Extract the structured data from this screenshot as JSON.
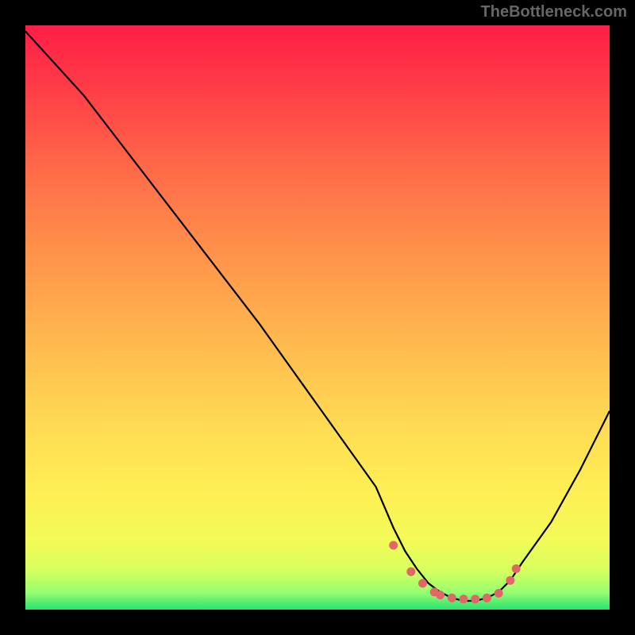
{
  "watermark": "TheBottleneck.com",
  "chart_data": {
    "type": "line",
    "title": "",
    "xlabel": "",
    "ylabel": "",
    "xlim": [
      0,
      100
    ],
    "ylim": [
      0,
      100
    ],
    "series": [
      {
        "name": "curve",
        "x": [
          0,
          10,
          20,
          30,
          40,
          50,
          60,
          63,
          65,
          67,
          69,
          71,
          73,
          75,
          77,
          79,
          81,
          83,
          85,
          90,
          95,
          100
        ],
        "y": [
          99,
          88,
          75,
          62,
          49,
          35,
          21,
          14,
          10,
          7,
          4.5,
          3,
          2,
          1.5,
          1.5,
          2,
          3,
          5,
          8,
          15,
          24,
          34
        ]
      },
      {
        "name": "dots",
        "x": [
          63,
          66,
          68,
          70,
          71,
          73,
          75,
          77,
          79,
          81,
          83,
          84
        ],
        "y": [
          11,
          6.5,
          4.5,
          3,
          2.5,
          2,
          1.8,
          1.8,
          2,
          2.8,
          5,
          7
        ]
      }
    ],
    "colors": {
      "curve": "#000000",
      "dots": "#e06767",
      "gradient_top": "#ff1e46",
      "gradient_bottom": "#26e36f"
    }
  }
}
